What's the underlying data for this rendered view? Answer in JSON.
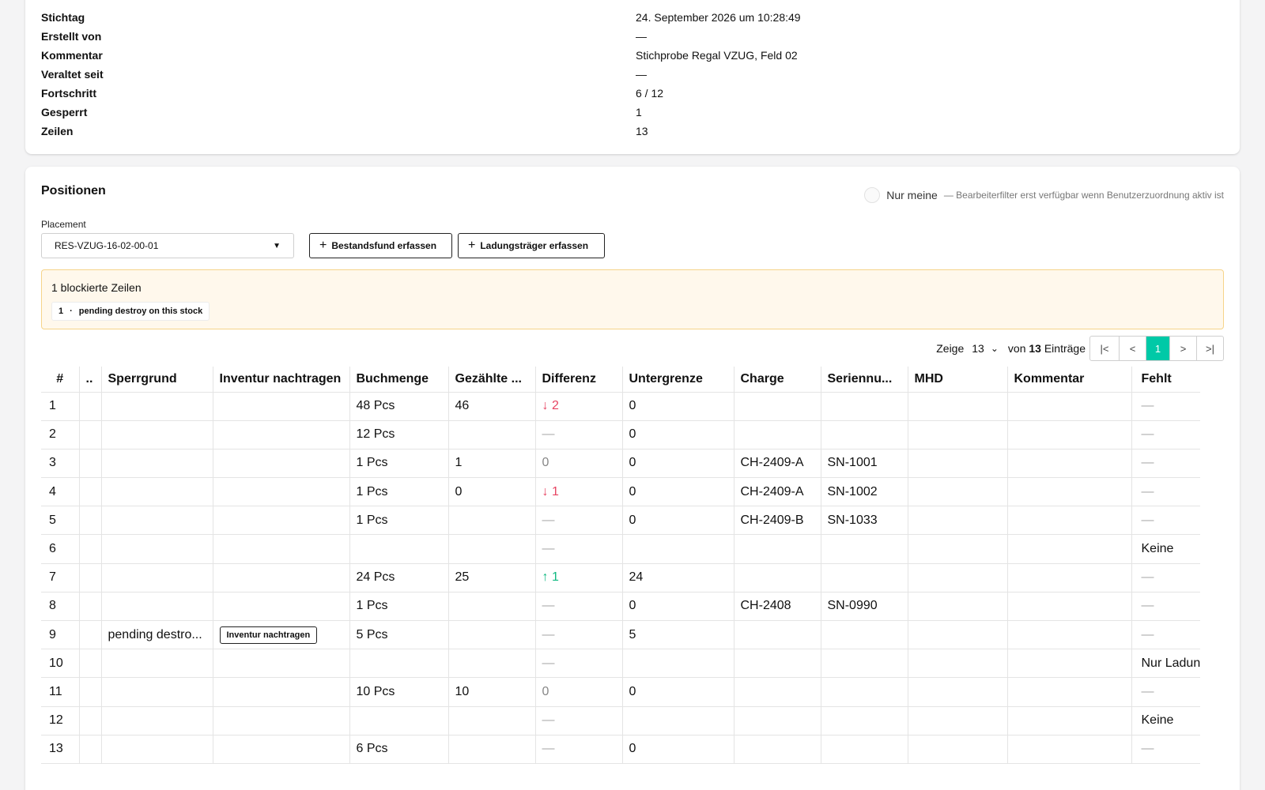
{
  "properties": [
    {
      "key": "Stichtag",
      "value": "24. September 2026 um 10:28:49"
    },
    {
      "key": "Erstellt von",
      "value": "—"
    },
    {
      "key": "Kommentar",
      "value": "Stichprobe Regal VZUG, Feld 02"
    },
    {
      "key": "Veraltet seit",
      "value": "—"
    },
    {
      "key": "Fortschritt",
      "value": "6 / 12"
    },
    {
      "key": "Gesperrt",
      "value": "1"
    },
    {
      "key": "Zeilen",
      "value": "13"
    }
  ],
  "positions": {
    "title": "Positionen",
    "filter": {
      "label": "Nur meine",
      "hint": "— Bearbeiterfilter erst verfügbar wenn Benutzerzuordnung aktiv ist"
    },
    "placement": {
      "label": "Placement",
      "value": "RES-VZUG-16-02-00-01"
    },
    "buttons": {
      "bestandsfund": "Bestandsfund erfassen",
      "ladungstraeger": "Ladungsträger erfassen"
    },
    "warning": {
      "title": "1 blockierte Zeilen",
      "chip_line": "1",
      "chip_sep": "·",
      "chip_reason": "pending destroy on this stock"
    },
    "pager": {
      "show": "Zeige",
      "size": "13",
      "of": "von",
      "total": "13",
      "entries": "Einträge",
      "first": "|<",
      "prev": "<",
      "page": "1",
      "next": ">",
      "last": ">|"
    }
  },
  "table": {
    "headers": [
      "#",
      "..",
      "Sperrgrund",
      "Inventur nachtragen",
      "Buchmenge",
      "Gezählte ...",
      "Differenz",
      "Untergrenze",
      "Charge",
      "Seriennu...",
      "MHD",
      "Kommentar",
      "Fehlt"
    ],
    "rows": [
      {
        "n": "1",
        "sperrgrund": "",
        "nachtragen": "",
        "buchmenge": "48 Pcs",
        "gezaehlt": "46",
        "diff": "↓ 2",
        "diff_type": "down",
        "untergrenze": "0",
        "charge": "",
        "serie": "",
        "mhd": "",
        "kommentar": "",
        "fehlt": "—"
      },
      {
        "n": "2",
        "sperrgrund": "",
        "nachtragen": "",
        "buchmenge": "12 Pcs",
        "gezaehlt": "",
        "diff": "—",
        "diff_type": "dash",
        "untergrenze": "0",
        "charge": "",
        "serie": "",
        "mhd": "",
        "kommentar": "",
        "fehlt": "—"
      },
      {
        "n": "3",
        "sperrgrund": "",
        "nachtragen": "",
        "buchmenge": "1 Pcs",
        "gezaehlt": "1",
        "diff": "0",
        "diff_type": "zero",
        "untergrenze": "0",
        "charge": "CH-2409-A",
        "serie": "SN-1001",
        "mhd": "",
        "kommentar": "",
        "fehlt": "—"
      },
      {
        "n": "4",
        "sperrgrund": "",
        "nachtragen": "",
        "buchmenge": "1 Pcs",
        "gezaehlt": "0",
        "diff": "↓ 1",
        "diff_type": "down",
        "untergrenze": "0",
        "charge": "CH-2409-A",
        "serie": "SN-1002",
        "mhd": "",
        "kommentar": "",
        "fehlt": "—"
      },
      {
        "n": "5",
        "sperrgrund": "",
        "nachtragen": "",
        "buchmenge": "1 Pcs",
        "gezaehlt": "",
        "diff": "—",
        "diff_type": "dash",
        "untergrenze": "0",
        "charge": "CH-2409-B",
        "serie": "SN-1033",
        "mhd": "",
        "kommentar": "",
        "fehlt": "—"
      },
      {
        "n": "6",
        "sperrgrund": "",
        "nachtragen": "",
        "buchmenge": "",
        "gezaehlt": "",
        "diff": "—",
        "diff_type": "dash",
        "untergrenze": "",
        "charge": "",
        "serie": "",
        "mhd": "",
        "kommentar": "",
        "fehlt": "Keine"
      },
      {
        "n": "7",
        "sperrgrund": "",
        "nachtragen": "",
        "buchmenge": "24 Pcs",
        "gezaehlt": "25",
        "diff": "↑ 1",
        "diff_type": "up",
        "untergrenze": "24",
        "charge": "",
        "serie": "",
        "mhd": "",
        "kommentar": "",
        "fehlt": "—"
      },
      {
        "n": "8",
        "sperrgrund": "",
        "nachtragen": "",
        "buchmenge": "1 Pcs",
        "gezaehlt": "",
        "diff": "—",
        "diff_type": "dash",
        "untergrenze": "0",
        "charge": "CH-2408",
        "serie": "SN-0990",
        "mhd": "",
        "kommentar": "",
        "fehlt": "—"
      },
      {
        "n": "9",
        "sperrgrund": "pending destro...",
        "nachtragen": "Inventur nachtragen",
        "buchmenge": "5 Pcs",
        "gezaehlt": "",
        "diff": "—",
        "diff_type": "dash",
        "untergrenze": "5",
        "charge": "",
        "serie": "",
        "mhd": "",
        "kommentar": "",
        "fehlt": "—"
      },
      {
        "n": "10",
        "sperrgrund": "",
        "nachtragen": "",
        "buchmenge": "",
        "gezaehlt": "",
        "diff": "—",
        "diff_type": "dash",
        "untergrenze": "",
        "charge": "",
        "serie": "",
        "mhd": "",
        "kommentar": "",
        "fehlt": "Nur Ladung"
      },
      {
        "n": "11",
        "sperrgrund": "",
        "nachtragen": "",
        "buchmenge": "10 Pcs",
        "gezaehlt": "10",
        "diff": "0",
        "diff_type": "zero",
        "untergrenze": "0",
        "charge": "",
        "serie": "",
        "mhd": "",
        "kommentar": "",
        "fehlt": "—"
      },
      {
        "n": "12",
        "sperrgrund": "",
        "nachtragen": "",
        "buchmenge": "",
        "gezaehlt": "",
        "diff": "—",
        "diff_type": "dash",
        "untergrenze": "",
        "charge": "",
        "serie": "",
        "mhd": "",
        "kommentar": "",
        "fehlt": "Keine"
      },
      {
        "n": "13",
        "sperrgrund": "",
        "nachtragen": "",
        "buchmenge": "6 Pcs",
        "gezaehlt": "",
        "diff": "—",
        "diff_type": "dash",
        "untergrenze": "0",
        "charge": "",
        "serie": "",
        "mhd": "",
        "kommentar": "",
        "fehlt": "—"
      }
    ]
  },
  "colors": {
    "accent": "#00c9a7",
    "down": "#e74462",
    "up": "#10b981",
    "warning_bg": "#fff8ec",
    "warning_border": "#f6d48a"
  }
}
